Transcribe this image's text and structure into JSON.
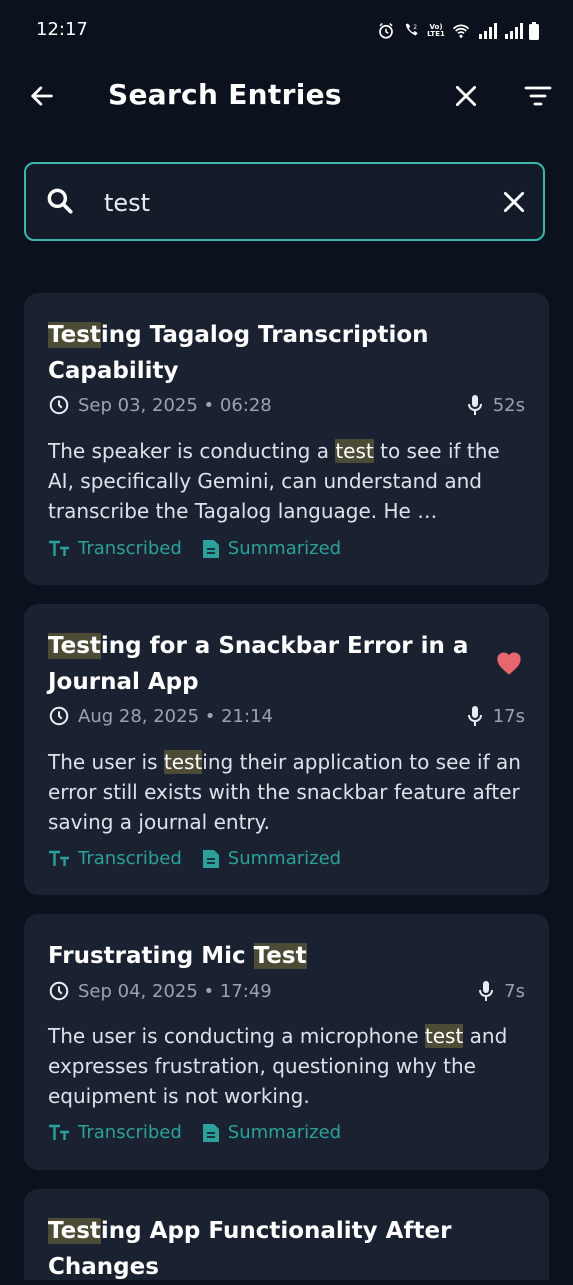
{
  "status_bar": {
    "time": "12:17",
    "volte_label": "Vo) LTE1"
  },
  "app_bar": {
    "title": "Search Entries"
  },
  "search": {
    "value": "test",
    "placeholder": ""
  },
  "colors": {
    "accent": "#3db5ad",
    "highlight": "#4b4b36",
    "heart": "#e8676f",
    "card": "#1a2232",
    "background": "#0b111d"
  },
  "entries": [
    {
      "title_hl": "Test",
      "title_rest": "ing Tagalog Transcription Capability",
      "date": "Sep 03, 2025 • 06:28",
      "duration": "52s",
      "summary_pre": "The speaker is conducting a ",
      "summary_hl": "test",
      "summary_post": " to see if the AI, specifically Gemini, can understand and transcribe the Tagalog language. He …",
      "tag1": "Transcribed",
      "tag2": "Summarized",
      "favorite": false
    },
    {
      "title_hl": "Test",
      "title_rest": "ing for a Snackbar Error in a Journal App",
      "date": "Aug 28, 2025 • 21:14",
      "duration": "17s",
      "summary_pre": "The user is ",
      "summary_hl": "test",
      "summary_post": "ing their application to see if an error still exists with the snackbar feature after saving a journal entry.",
      "tag1": "Transcribed",
      "tag2": "Summarized",
      "favorite": true
    },
    {
      "title_pre": "Frustrating Mic ",
      "title_hl": "Test",
      "date": "Sep 04, 2025 • 17:49",
      "duration": "7s",
      "summary_pre": "The user is conducting a microphone ",
      "summary_hl": "test",
      "summary_post": " and expresses frustration, questioning why the equipment is not working.",
      "tag1": "Transcribed",
      "tag2": "Summarized",
      "favorite": false
    },
    {
      "title_hl": "Test",
      "title_rest": "ing App Functionality After Changes"
    }
  ]
}
